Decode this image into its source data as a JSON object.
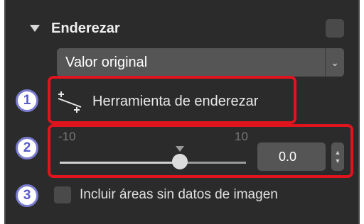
{
  "section": {
    "title": "Enderezar",
    "enabled": false
  },
  "preset_dropdown": {
    "selected": "Valor original",
    "arrow": "⌄"
  },
  "callouts": {
    "one": "1",
    "two": "2",
    "three": "3"
  },
  "straighten_tool": {
    "label": "Herramienta de enderezar",
    "icon": "straighten-tool-icon"
  },
  "angle_slider": {
    "min_label": "-10",
    "max_label": "10",
    "min": -10,
    "max": 10,
    "value": 0.0,
    "value_text": "0.0"
  },
  "include_empty_areas": {
    "label": "Incluir áreas sin datos de imagen",
    "checked": false
  },
  "colors": {
    "panel_bg": "#2b2b2b",
    "control_bg": "#555555",
    "callout_red": "#e0141e",
    "badge_purple": "#7a7ccf"
  }
}
